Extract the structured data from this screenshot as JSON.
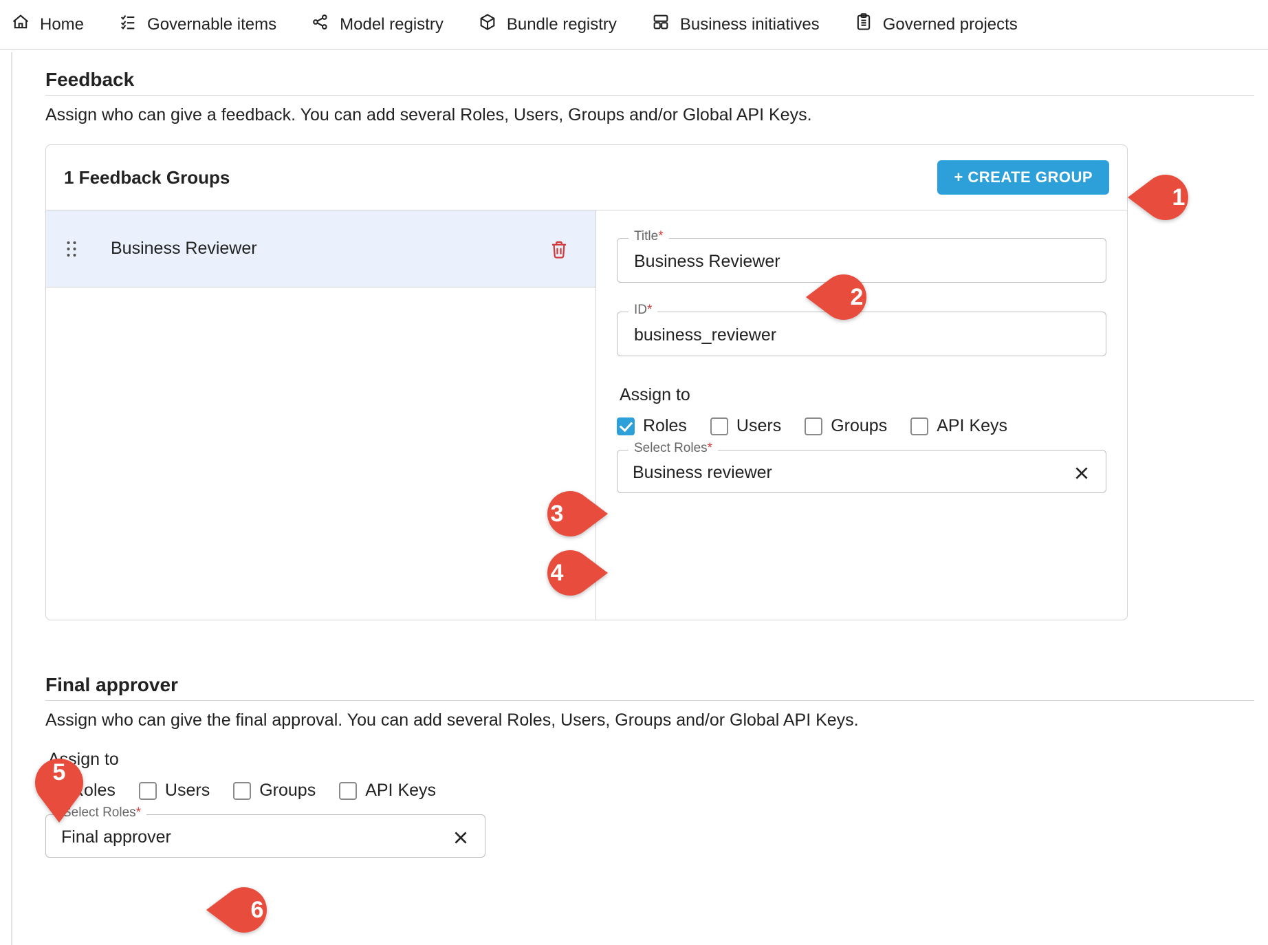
{
  "nav": {
    "home": "Home",
    "governable": "Governable items",
    "model_registry": "Model registry",
    "bundle_registry": "Bundle registry",
    "business_initiatives": "Business initiatives",
    "governed_projects": "Governed projects"
  },
  "feedback": {
    "title": "Feedback",
    "desc": "Assign who can give a feedback. You can add several Roles, Users, Groups and/or Global API Keys.",
    "groups_title": "1 Feedback Groups",
    "create_btn": "+ CREATE GROUP",
    "group_row_name": "Business Reviewer",
    "form": {
      "title_label": "Title",
      "title_value": "Business Reviewer",
      "id_label": "ID",
      "id_value": "business_reviewer",
      "assign_to_label": "Assign to",
      "checks": {
        "roles": "Roles",
        "users": "Users",
        "groups": "Groups",
        "apikeys": "API Keys"
      },
      "checked": {
        "roles": true,
        "users": false,
        "groups": false,
        "apikeys": false
      },
      "select_roles_label": "Select Roles",
      "select_roles_value": "Business reviewer"
    }
  },
  "final_approver": {
    "title": "Final approver",
    "desc": "Assign who can give the final approval. You can add several Roles, Users, Groups and/or Global API Keys.",
    "assign_to_label": "Assign to",
    "checks": {
      "roles": "Roles",
      "users": "Users",
      "groups": "Groups",
      "apikeys": "API Keys"
    },
    "checked": {
      "roles": true,
      "users": false,
      "groups": false,
      "apikeys": false
    },
    "select_roles_label": "Select Roles",
    "select_roles_value": "Final approver"
  },
  "annotations": [
    "1",
    "2",
    "3",
    "4",
    "5",
    "6"
  ],
  "colors": {
    "accent": "#2d9fd9",
    "annotation": "#e84c3d",
    "danger": "#d23a3a"
  }
}
